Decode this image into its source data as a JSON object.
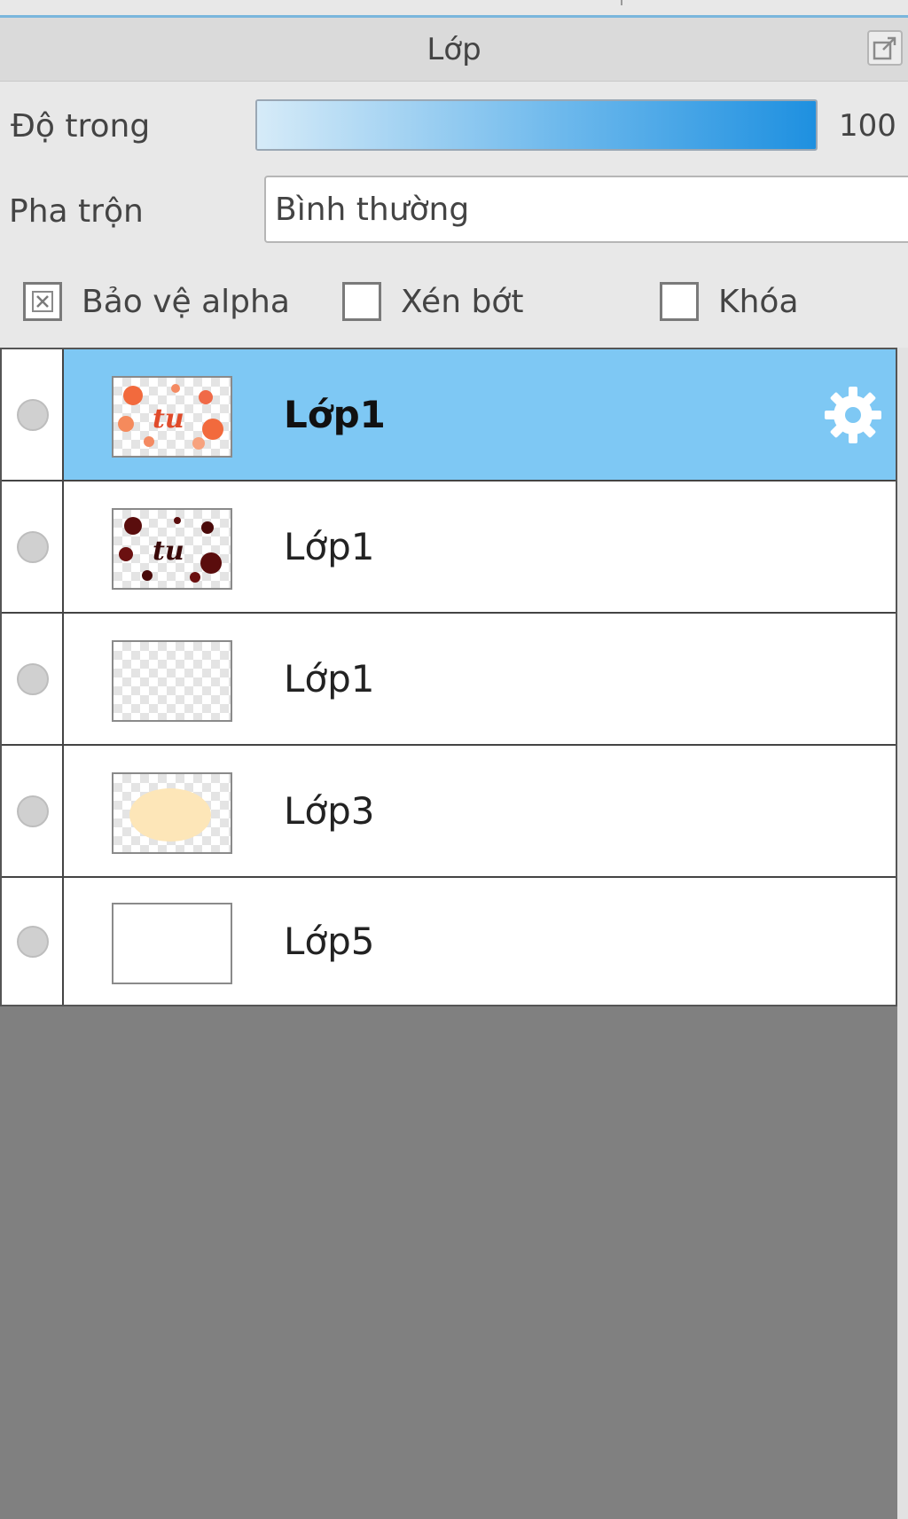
{
  "panel": {
    "title": "Lớp",
    "popout_icon": "popout-icon"
  },
  "properties": {
    "opacity_label": "Độ trong",
    "opacity_value": "100",
    "opacity_level": 1.0,
    "blend_label": "Pha trộn",
    "blend_value": "Bình thường"
  },
  "options": {
    "protect_alpha": {
      "label": "Bảo vệ alpha",
      "checked": true
    },
    "clipping": {
      "label": "Xén bớt",
      "checked": false
    },
    "lock": {
      "label": "Khóa",
      "checked": false
    }
  },
  "layers": [
    {
      "name": "Lớp1",
      "selected": true,
      "thumbnail": "orange-lettering-art",
      "settings_icon": "gear-icon"
    },
    {
      "name": "Lớp1",
      "selected": false,
      "thumbnail": "dark-red-lettering-art"
    },
    {
      "name": "Lớp1",
      "selected": false,
      "thumbnail": "transparent"
    },
    {
      "name": "Lớp3",
      "selected": false,
      "thumbnail": "cream-blob"
    },
    {
      "name": "Lớp5",
      "selected": false,
      "thumbnail": "white"
    }
  ],
  "colors": {
    "selected_row": "#7ec8f4",
    "opacity_fill": "#1e90e0",
    "empty_area": "#808080"
  }
}
